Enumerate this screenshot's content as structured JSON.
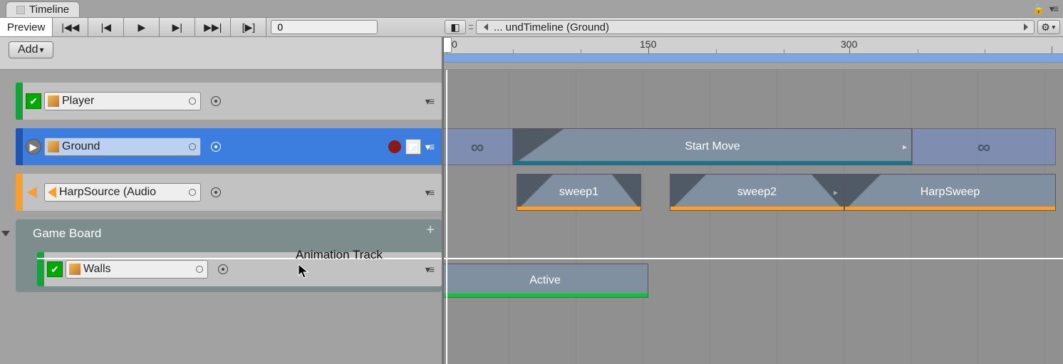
{
  "window": {
    "tab_title": "Timeline"
  },
  "toolbar": {
    "preview_label": "Preview",
    "frame_value": "0",
    "asset_name": "... undTimeline (Ground)"
  },
  "add_button": "Add",
  "ruler": {
    "ticks": [
      0,
      150,
      300
    ]
  },
  "tracks": {
    "player": {
      "name": "Player",
      "type": "animation",
      "color": "#14a33a"
    },
    "ground": {
      "name": "Ground",
      "type": "animation",
      "color": "#2f6dd0",
      "selected": true
    },
    "harp": {
      "name": "HarpSource (Audio",
      "type": "audio",
      "color": "#f5a030"
    },
    "group": {
      "name": "Game Board"
    },
    "walls": {
      "name": "Walls",
      "type": "activation",
      "color": "#14a33a"
    }
  },
  "tooltip": "Animation Track",
  "clips": {
    "ground": {
      "name": "Start Move",
      "start": 100,
      "end": 660,
      "color": "#207088",
      "pre_start": 0,
      "pre_end": 100,
      "post_start": 660,
      "post_end": 862
    },
    "audio": [
      {
        "name": "sweep1",
        "start": 105,
        "end": 280,
        "color": "#f5a030"
      },
      {
        "name": "sweep2",
        "start": 320,
        "end": 570,
        "color": "#f5a030"
      },
      {
        "name": "HarpSweep",
        "start": 570,
        "end": 862,
        "color": "#f5a030"
      }
    ],
    "walls": {
      "name": "Active",
      "start": 0,
      "end": 290,
      "color": "#14c040"
    }
  }
}
